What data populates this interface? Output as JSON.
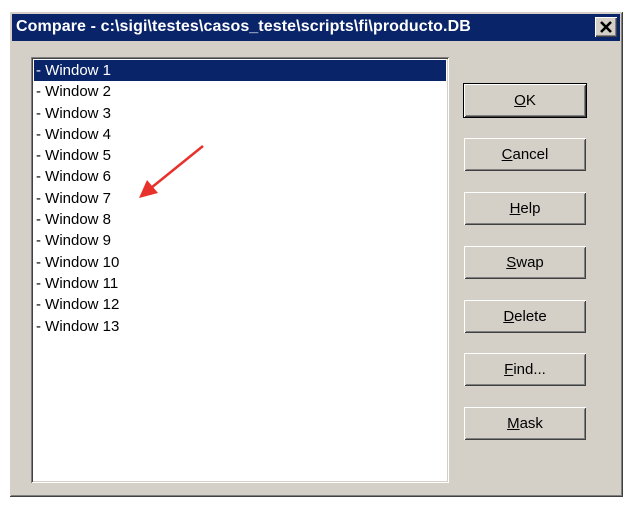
{
  "window": {
    "title": "Compare - c:\\sigi\\testes\\casos_teste\\scripts\\fi\\producto.DB"
  },
  "list": {
    "items": [
      "- Window 1",
      "- Window 2",
      "- Window 3",
      "- Window 4",
      "- Window 5",
      "- Window 6",
      "- Window 7",
      "- Window 8",
      "- Window 9",
      "- Window 10",
      "- Window 11",
      "- Window 12",
      "- Window 13"
    ],
    "selected": "- Window 1"
  },
  "buttons": {
    "ok": {
      "mnemonic": "O",
      "rest": "K"
    },
    "cancel": {
      "mnemonic": "C",
      "rest": "ancel"
    },
    "help": {
      "mnemonic": "H",
      "rest": "elp"
    },
    "swap": {
      "mnemonic": "S",
      "rest": "wap"
    },
    "delete": {
      "mnemonic": "D",
      "rest": "elete"
    },
    "find": {
      "mnemonic": "F",
      "rest": "ind..."
    },
    "mask": {
      "mnemonic": "M",
      "rest": "ask"
    }
  },
  "icons": {
    "close": "close-icon",
    "annotation": "red-arrow-icon"
  },
  "colors": {
    "title_bar": "#0a246a",
    "face": "#d4d0c8",
    "selection": "#0a246a",
    "annotation_arrow": "#e8312a"
  }
}
